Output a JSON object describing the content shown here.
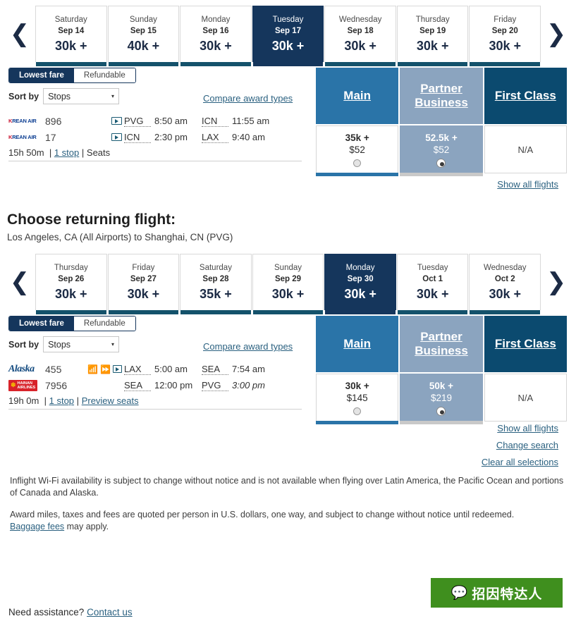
{
  "outbound": {
    "carousel": {
      "prev_label": "‹",
      "next_label": "›",
      "days": [
        {
          "dow": "Saturday",
          "date": "Sep 14",
          "miles": "30k +",
          "selected": false
        },
        {
          "dow": "Sunday",
          "date": "Sep 15",
          "miles": "40k +",
          "selected": false
        },
        {
          "dow": "Monday",
          "date": "Sep 16",
          "miles": "30k +",
          "selected": false
        },
        {
          "dow": "Tuesday",
          "date": "Sep 17",
          "miles": "30k +",
          "selected": true
        },
        {
          "dow": "Wednesday",
          "date": "Sep 18",
          "miles": "30k +",
          "selected": false
        },
        {
          "dow": "Thursday",
          "date": "Sep 19",
          "miles": "30k +",
          "selected": false
        },
        {
          "dow": "Friday",
          "date": "Sep 20",
          "miles": "30k +",
          "selected": false
        }
      ]
    },
    "toggle": {
      "on": "Lowest fare",
      "off": "Refundable"
    },
    "sort": {
      "label": "Sort by",
      "value": "Stops",
      "caret": "▾"
    },
    "compare_link": "Compare award types",
    "legs": [
      {
        "airline": "korean-air",
        "number": "896",
        "origin": "PVG",
        "depart": "8:50 am",
        "dest": "ICN",
        "arrive": "11:55 am",
        "wifi": false,
        "power": false,
        "video": true,
        "next_day": false
      },
      {
        "airline": "korean-air",
        "number": "17",
        "origin": "ICN",
        "depart": "2:30 pm",
        "dest": "LAX",
        "arrive": "9:40 am",
        "wifi": false,
        "power": false,
        "video": true,
        "next_day": false
      }
    ],
    "duration": "15h 50m",
    "stops": "1 stop",
    "seats_link": "Seats",
    "columns": [
      {
        "name": "Main",
        "price_miles": "35k +",
        "price_cash": "$52",
        "selected": false,
        "available": true,
        "style": "white"
      },
      {
        "name": "Partner Business",
        "price_miles": "52.5k +",
        "price_cash": "$52",
        "selected": true,
        "available": true,
        "style": "blue"
      },
      {
        "name": "First Class",
        "price_miles": "",
        "price_cash": "",
        "na": "N/A",
        "selected": false,
        "available": false,
        "style": "white"
      }
    ],
    "show_all": "Show all flights"
  },
  "return": {
    "heading": "Choose returning flight:",
    "subheading": "Los Angeles, CA (All Airports) to Shanghai, CN (PVG)",
    "carousel": {
      "days": [
        {
          "dow": "Thursday",
          "date": "Sep 26",
          "miles": "30k +",
          "selected": false
        },
        {
          "dow": "Friday",
          "date": "Sep 27",
          "miles": "30k +",
          "selected": false
        },
        {
          "dow": "Saturday",
          "date": "Sep 28",
          "miles": "35k +",
          "selected": false
        },
        {
          "dow": "Sunday",
          "date": "Sep 29",
          "miles": "30k +",
          "selected": false
        },
        {
          "dow": "Monday",
          "date": "Sep 30",
          "miles": "30k +",
          "selected": true
        },
        {
          "dow": "Tuesday",
          "date": "Oct 1",
          "miles": "30k +",
          "selected": false
        },
        {
          "dow": "Wednesday",
          "date": "Oct 2",
          "miles": "30k +",
          "selected": false
        }
      ]
    },
    "toggle": {
      "on": "Lowest fare",
      "off": "Refundable"
    },
    "sort": {
      "label": "Sort by",
      "value": "Stops",
      "caret": "▾"
    },
    "compare_link": "Compare award types",
    "legs": [
      {
        "airline": "alaska",
        "number": "455",
        "origin": "LAX",
        "depart": "5:00 am",
        "dest": "SEA",
        "arrive": "7:54 am",
        "wifi": true,
        "power": true,
        "video": true,
        "next_day": false
      },
      {
        "airline": "hainan",
        "number": "7956",
        "origin": "SEA",
        "depart": "12:00 pm",
        "dest": "PVG",
        "arrive": "3:00 pm",
        "wifi": false,
        "power": false,
        "video": false,
        "next_day": true
      }
    ],
    "duration": "19h 0m",
    "stops": "1 stop",
    "seats_link": "Preview seats",
    "columns": [
      {
        "name": "Main",
        "price_miles": "30k +",
        "price_cash": "$145",
        "selected": false,
        "available": true,
        "style": "white"
      },
      {
        "name": "Partner Business",
        "price_miles": "50k +",
        "price_cash": "$219",
        "selected": true,
        "available": true,
        "style": "blue"
      },
      {
        "name": "First Class",
        "price_miles": "",
        "price_cash": "",
        "na": "N/A",
        "selected": false,
        "available": false,
        "style": "white"
      }
    ],
    "show_all": "Show all flights"
  },
  "links": {
    "change_search": "Change search",
    "clear_all": "Clear all selections"
  },
  "footer": {
    "wifi_disclaimer": "Inflight Wi-Fi availability is subject to change without notice and is not available when flying over Latin America, the Pacific Ocean and portions of Canada and Alaska.",
    "award_disclaimer": "Award miles, taxes and fees are quoted per person in U.S. dollars, one way, and subject to change without notice until redeemed.",
    "baggage_link": "Baggage fees",
    "baggage_tail": " may apply.",
    "need_assistance": "Need assistance? ",
    "contact_link": "Contact us"
  },
  "watermark": {
    "text": "招因特达人",
    "bg_color": "#3f8f1e"
  },
  "airlines": {
    "korean_air": {
      "k": "K",
      "rest": "REAN AIR"
    },
    "alaska": "Alaska",
    "hainan": {
      "line1": "HAINAN",
      "line2": "AIRLINES"
    }
  },
  "colors": {
    "navy": "#15365c",
    "teal_bar": "#14526b",
    "main_blue": "#2a74a8",
    "partner_blue": "#8ba4bf",
    "first_navy": "#0b4a6f",
    "link": "#2b6180"
  }
}
